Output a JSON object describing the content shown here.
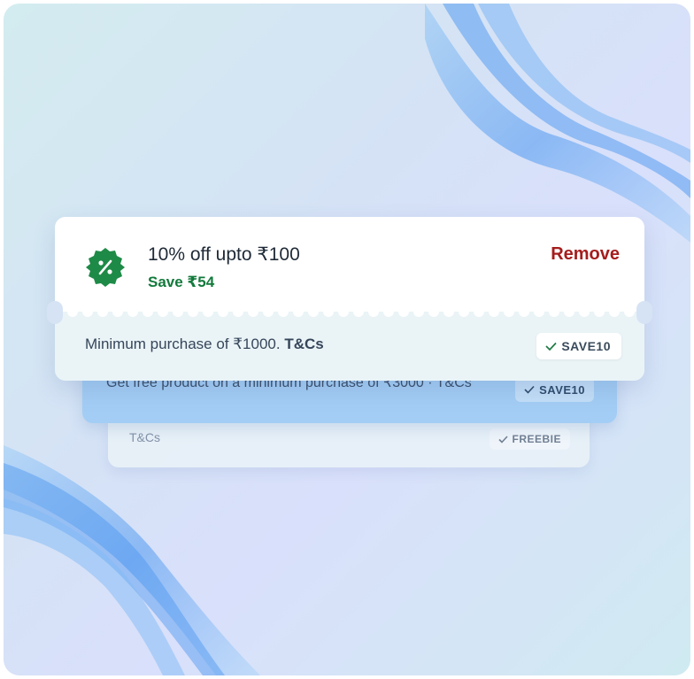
{
  "front_coupon": {
    "title": "10% off upto ₹100",
    "savings": "Save ₹54",
    "action": "Remove",
    "description": "Minimum purchase of ₹1000. ",
    "terms": "T&Cs",
    "code": "SAVE10",
    "badge_icon": "percent-badge-icon"
  },
  "middle_coupon": {
    "description": "Get free product on a minimum purchase of ₹3000 · T&Cs",
    "code": "SAVE10"
  },
  "back_coupon": {
    "description": "T&Cs",
    "code": "FREEBIE"
  },
  "colors": {
    "savings_green": "#137a3c",
    "remove_red": "#a51d1d",
    "badge_green": "#1e8a47",
    "middle_card_blue": "#a3cdf4"
  }
}
